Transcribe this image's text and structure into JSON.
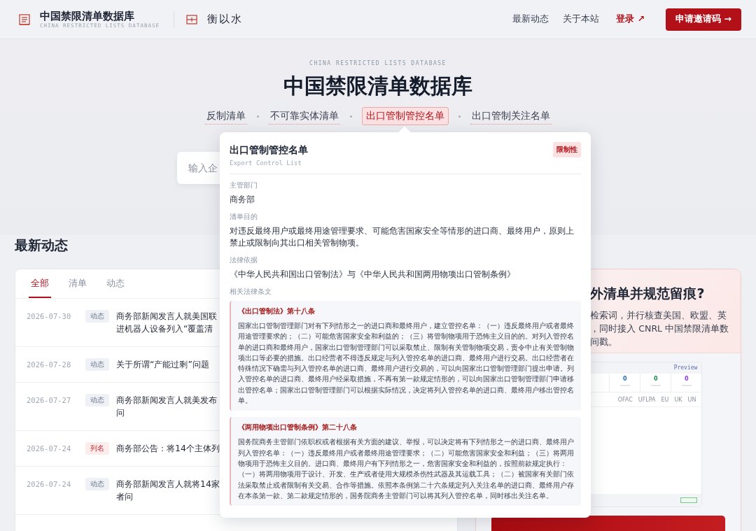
{
  "header": {
    "title": "中国禁限清单数据库",
    "subtitle": "CHINA RESTRICTED LISTS DATABASE",
    "partner": "衡以水",
    "nav": [
      {
        "label": "最新动态",
        "kind": "link"
      },
      {
        "label": "关于本站",
        "kind": "link"
      },
      {
        "label": "登录 ↗",
        "kind": "login"
      },
      {
        "label": "申请邀请码 →",
        "kind": "cta"
      }
    ]
  },
  "hero": {
    "kicker": "CHINA RESTRICTED LISTS DATABASE",
    "title": "中国禁限清单数据库",
    "lists": [
      {
        "label": "反制清单",
        "selected": false
      },
      {
        "label": "不可靠实体清单",
        "selected": false
      },
      {
        "label": "出口管制管控名单",
        "selected": true
      },
      {
        "label": "出口管制关注名单",
        "selected": false
      }
    ],
    "search": {
      "placeholder": "输入企"
    }
  },
  "popover": {
    "title": "出口管制管控名单",
    "badge": "限制性",
    "subtitle": "Export Control List",
    "fields": [
      {
        "label": "主管部门",
        "value": "商务部"
      },
      {
        "label": "清单目的",
        "value": "对违反最终用户或最终用途管理要求、可能危害国家安全等情形的进口商、最终用户，原则上禁止或限制向其出口相关管制物项。"
      },
      {
        "label": "法律依据",
        "value": "《中华人民共和国出口管制法》与《中华人民共和国两用物项出口管制条例》"
      }
    ],
    "articles_label": "相关法律条文",
    "articles": [
      {
        "title": "《出口管制法》第十八条",
        "text": "国家出口管制管理部门对有下列情形之一的进口商和最终用户，建立管控名单：（一）违反最终用户或者最终用途管理要求的；（二）可能危害国家安全和利益的；（三）将管制物项用于恐怖主义目的的。对列入管控名单的进口商和最终用户，国家出口管制管理部门可以采取禁止、限制有关管制物项交易，责令中止有关管制物项出口等必要的措施。出口经营者不得违反规定与列入管控名单的进口商、最终用户进行交易。出口经营者在特殊情况下确需与列入管控名单的进口商、最终用户进行交易的，可以向国家出口管制管理部门提出申请。列入管控名单的进口商、最终用户经采取措施，不再有第一款规定情形的，可以向国家出口管制管理部门申请移出管控名单；国家出口管制管理部门可以根据实际情况，决定将列入管控名单的进口商、最终用户移出管控名单。"
      },
      {
        "title": "《两用物项出口管制条例》第二十八条",
        "text": "国务院商务主管部门依职权或者根据有关方面的建议、举报，可以决定将有下列情形之一的进口商、最终用户列入管控名单：（一）违反最终用户或者最终用途管理要求；（二）可能危害国家安全和利益；（三）将两用物项用于恐怖主义目的。进口商、最终用户有下列情形之一，危害国家安全和利益的，按照前款规定执行：（一）将两用物项用于设计、开发、生产或者使用大规模杀伤性武器及其运载工具；（二）被国家有关部门依法采取禁止或者限制有关交易、合作等措施。依照本条例第二十六条规定列入关注名单的进口商、最终用户存在本条第一款、第二款规定情形的，国务院商务主管部门可以将其列入管控名单，同时移出关注名单。"
      }
    ]
  },
  "news": {
    "heading": "最新动态",
    "tabs": [
      {
        "label": "全部",
        "selected": true
      },
      {
        "label": "清单",
        "selected": false
      },
      {
        "label": "动态",
        "selected": false
      }
    ],
    "rows": [
      {
        "date": "2026-07-30",
        "tag": "动态",
        "kind": "update",
        "title_lines": [
          "商务部新闻发言人就美国联",
          "进机器人设备列入“覆盖清"
        ]
      },
      {
        "date": "2026-07-28",
        "tag": "动态",
        "kind": "update",
        "title_lines": [
          "关于所谓“产能过剩”问题"
        ]
      },
      {
        "date": "2026-07-27",
        "tag": "动态",
        "kind": "update",
        "title_lines": [
          "商务部新闻发言人就美发布",
          "问"
        ]
      },
      {
        "date": "2026-07-24",
        "tag": "列名",
        "kind": "listing",
        "title_lines": [
          "商务部公告：将14个主体列"
        ]
      },
      {
        "date": "2026-07-24",
        "tag": "动态",
        "kind": "update",
        "title_lines": [
          "商务部新闻发言人就将14家",
          "者问"
        ]
      }
    ]
  },
  "promo": {
    "heading": "外清单并规范留痕?",
    "text_lines": [
      "检索词，并行核查美国、欧盟、英",
      "，同时接入 CNRL 中国禁限清单数",
      "间戳。"
    ],
    "preview": {
      "label": "Preview",
      "stats": [
        {
          "value": "0",
          "color": "#1f6fb2"
        },
        {
          "value": "0",
          "color": "#1a8a4a"
        },
        {
          "value": "0",
          "color": "#9333ea"
        }
      ],
      "columns": [
        "OFAC",
        "UFLPA",
        "EU",
        "UK",
        "UN"
      ]
    }
  }
}
